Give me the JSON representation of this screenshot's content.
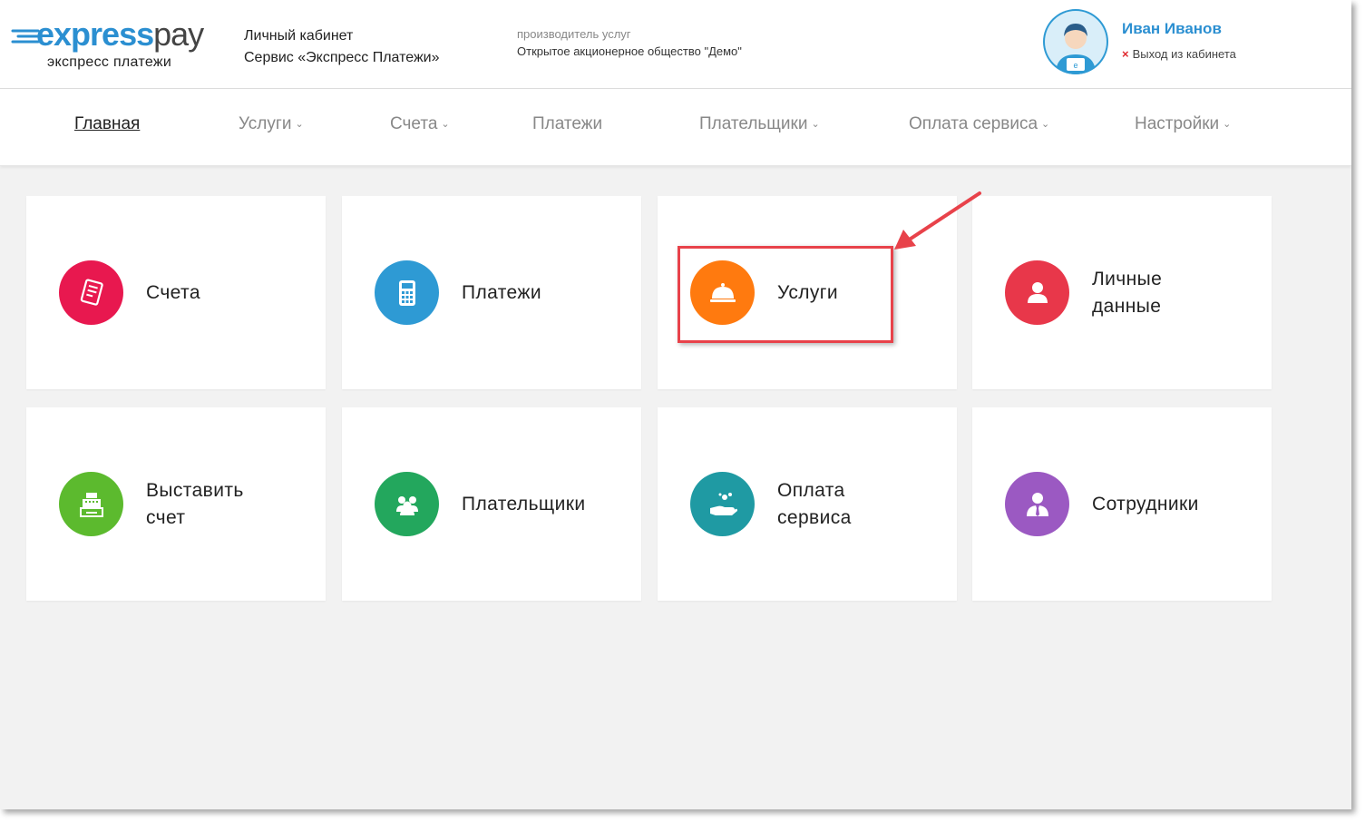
{
  "logo": {
    "word_express": "express",
    "word_pay": "pay",
    "subtitle": "экспресс платежи"
  },
  "header": {
    "cabinet_line1": "Личный кабинет",
    "cabinet_line2": "Сервис «Экспресс Платежи»",
    "provider_label": "производитель услуг",
    "provider_name": "Открытое акционерное общество \"Демо\""
  },
  "user": {
    "name": "Иван Иванов",
    "logout_label": "Выход из кабинета",
    "logout_icon": "×"
  },
  "nav": {
    "items": [
      {
        "label": "Главная",
        "dropdown": false,
        "active": true
      },
      {
        "label": "Услуги",
        "dropdown": true
      },
      {
        "label": "Счета",
        "dropdown": true
      },
      {
        "label": "Платежи",
        "dropdown": false
      },
      {
        "label": "Плательщики",
        "dropdown": true
      },
      {
        "label": "Оплата сервиса",
        "dropdown": true
      },
      {
        "label": "Настройки",
        "dropdown": true
      }
    ],
    "chevron": "⌄"
  },
  "tiles": [
    {
      "label_line1": "Счета",
      "label_line2": "",
      "icon": "invoice-icon",
      "color": "#e8184f"
    },
    {
      "label_line1": "Платежи",
      "label_line2": "",
      "icon": "terminal-icon",
      "color": "#2e9ad4"
    },
    {
      "label_line1": "Услуги",
      "label_line2": "",
      "icon": "cloche-icon",
      "color": "#ff7a0f"
    },
    {
      "label_line1": "Личные",
      "label_line2": "данные",
      "icon": "person-icon",
      "color": "#e8374a"
    },
    {
      "label_line1": "Выставить",
      "label_line2": "счет",
      "icon": "cash-register-icon",
      "color": "#5cba2e"
    },
    {
      "label_line1": "Плательщики",
      "label_line2": "",
      "icon": "people-icon",
      "color": "#23a75d"
    },
    {
      "label_line1": "Оплата",
      "label_line2": "сервиса",
      "icon": "hand-coins-icon",
      "color": "#1f9aa3"
    },
    {
      "label_line1": "Сотрудники",
      "label_line2": "",
      "icon": "employee-icon",
      "color": "#9b59c2"
    }
  ],
  "annotation": {
    "highlight_color": "#e8424a",
    "target": "Услуги"
  }
}
